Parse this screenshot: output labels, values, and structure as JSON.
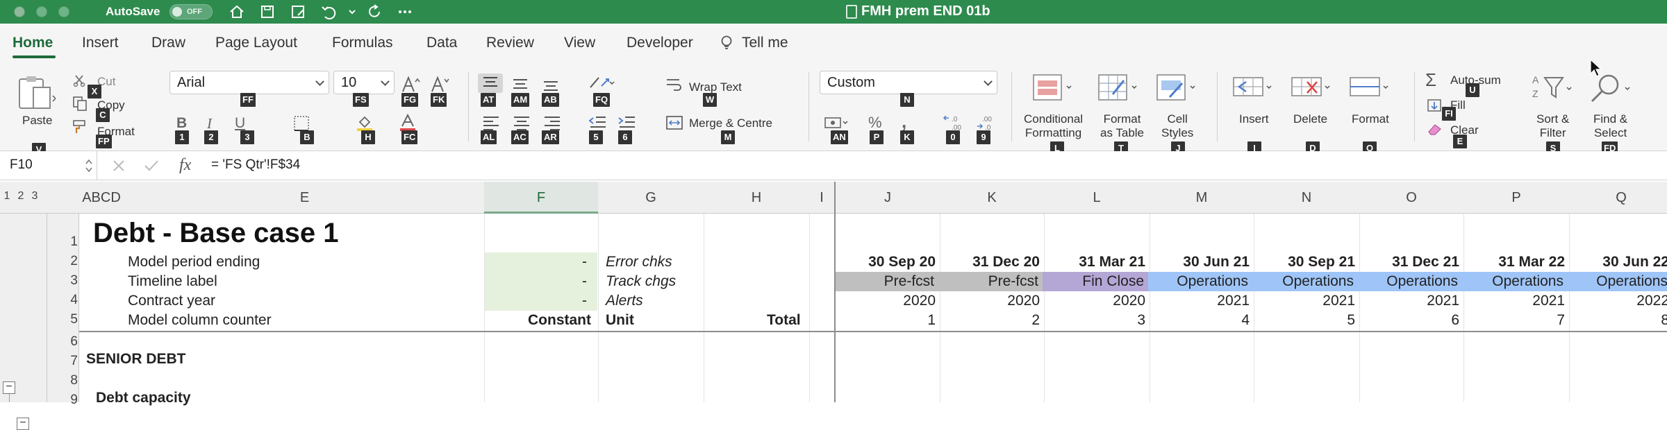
{
  "titlebar": {
    "autosave_label": "AutoSave",
    "autosave_state": "OFF",
    "doc_title": "FMH prem END 01b"
  },
  "tabs": [
    "Home",
    "Insert",
    "Draw",
    "Page Layout",
    "Formulas",
    "Data",
    "Review",
    "View",
    "Developer",
    "Tell me"
  ],
  "ribbon": {
    "paste": "Paste",
    "cut": "Cut",
    "copy": "Copy",
    "format": "Format",
    "font_name": "Arial",
    "font_size": "10",
    "wrap_text": "Wrap Text",
    "merge_centre": "Merge & Centre",
    "number_format": "Custom",
    "conditional_formatting": [
      "Conditional",
      "Formatting"
    ],
    "format_as_table": [
      "Format",
      "as Table"
    ],
    "cell_styles": [
      "Cell",
      "Styles"
    ],
    "insert": "Insert",
    "delete": "Delete",
    "format_cells": "Format",
    "autosum": "Auto-sum",
    "fill": "Fill",
    "clear": "Clear",
    "sort_filter": [
      "Sort &",
      "Filter"
    ],
    "find_select": [
      "Find &",
      "Select"
    ],
    "keytips": {
      "x": "X",
      "c": "C",
      "fp": "FP",
      "v": "V",
      "ff": "FF",
      "fs": "FS",
      "fg": "FG",
      "fk": "FK",
      "one": "1",
      "two": "2",
      "three": "3",
      "b": "B",
      "h": "H",
      "fc": "FC",
      "at": "AT",
      "am": "AM",
      "ab": "AB",
      "al": "AL",
      "ac": "AC",
      "ar": "AR",
      "fq": "FQ",
      "five": "5",
      "six": "6",
      "w": "W",
      "m": "M",
      "n": "N",
      "an": "AN",
      "p": "P",
      "k": "K",
      "zero": "0",
      "nine": "9",
      "l": "L",
      "t": "T",
      "j": "J",
      "i": "I",
      "d": "D",
      "o": "O",
      "u": "U",
      "fi": "FI",
      "e": "E",
      "s": "S",
      "fd": "FD"
    }
  },
  "formulabar": {
    "namebox": "F10",
    "fx": "fx",
    "formula": "= 'FS Qtr'!F$34"
  },
  "grid": {
    "outline_levels": [
      "1",
      "2",
      "3"
    ],
    "col_headers": [
      "ABCD",
      "E",
      "F",
      "G",
      "H",
      "I",
      "J",
      "K",
      "L",
      "M",
      "N",
      "O",
      "P",
      "Q"
    ],
    "row_numbers": [
      "1",
      "2",
      "3",
      "4",
      "5",
      "6",
      "7",
      "8",
      "9"
    ],
    "title": "Debt - Base case 1",
    "rows": {
      "model_period": "Model period ending",
      "timeline": "Timeline label",
      "contract_year": "Contract year",
      "column_counter": "Model column counter",
      "senior_debt": "SENIOR DEBT",
      "debt_capacity": "Debt capacity"
    },
    "f_values": [
      "-",
      "-",
      "-"
    ],
    "checks": [
      "Error chks",
      "Track chgs",
      "Alerts"
    ],
    "headers": {
      "constant": "Constant",
      "unit": "Unit",
      "total": "Total"
    },
    "periods": [
      "30 Sep 20",
      "31 Dec 20",
      "31 Mar 21",
      "30 Jun 21",
      "30 Sep 21",
      "31 Dec 21",
      "31 Mar 22",
      "30 Jun 22"
    ],
    "timeline_labels": [
      "Pre-fcst",
      "Pre-fcst",
      "Fin Close",
      "Operations",
      "Operations",
      "Operations",
      "Operations",
      "Operations"
    ],
    "contract_years": [
      "2020",
      "2020",
      "2020",
      "2021",
      "2021",
      "2021",
      "2021",
      "2022"
    ],
    "counters": [
      "1",
      "2",
      "3",
      "4",
      "5",
      "6",
      "7",
      "8"
    ]
  },
  "colors": {
    "titlebar": "#2e8b4e",
    "prefcst": "#bfbfbf",
    "finclose": "#b4a7d6",
    "operations": "#9fc5f8",
    "input_green": "#e5f1dc"
  }
}
